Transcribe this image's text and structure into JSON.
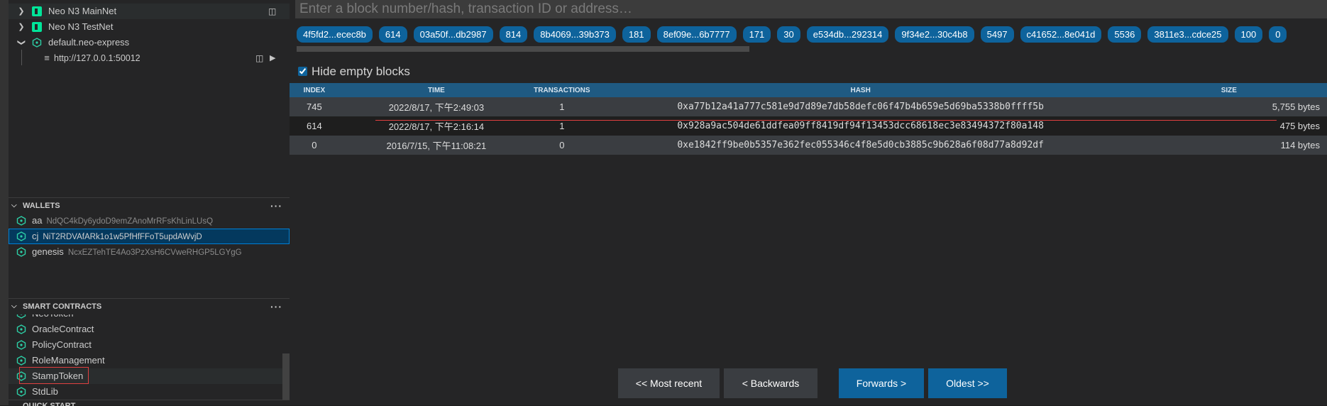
{
  "sidebar": {
    "networks": [
      {
        "label": "Neo N3 MainNet"
      },
      {
        "label": "Neo N3 TestNet"
      },
      {
        "label": "default.neo-express"
      }
    ],
    "rpc_url": "http://127.0.0.1:50012",
    "wallets_header": "WALLETS",
    "wallets": [
      {
        "name": "aa",
        "address": "NdQC4kDy6ydoD9emZAnoMrRFsKhLinLUsQ"
      },
      {
        "name": "cj",
        "address": "NiT2RDVAfARk1o1w5PfHfFFoT5updAWvjD"
      },
      {
        "name": "genesis",
        "address": "NcxEZTehTE4Ao3PzXsH6CVweRHGP5LGYgG"
      }
    ],
    "contracts_header": "SMART CONTRACTS",
    "contracts": [
      {
        "name": "NeoToken"
      },
      {
        "name": "OracleContract"
      },
      {
        "name": "PolicyContract"
      },
      {
        "name": "RoleManagement"
      },
      {
        "name": "StampToken"
      },
      {
        "name": "StdLib"
      }
    ],
    "quickstart_header": "QUICK START"
  },
  "main": {
    "search_placeholder": "Enter a block number/hash, transaction ID or address…",
    "history": [
      "4f5fd2...ecec8b",
      "614",
      "03a50f...db2987",
      "814",
      "8b4069...39b373",
      "181",
      "8ef09e...6b7777",
      "171",
      "30",
      "e534db...292314",
      "9f34e2...30c4b8",
      "5497",
      "c41652...8e041d",
      "5536",
      "3811e3...cdce25",
      "100",
      "0"
    ],
    "hide_empty_label": "Hide empty blocks",
    "hide_empty_checked": true,
    "columns": {
      "index": "INDEX",
      "time": "TIME",
      "transactions": "TRANSACTIONS",
      "hash": "HASH",
      "size": "SIZE"
    },
    "blocks": [
      {
        "index": "745",
        "time": "2022/8/17, 下午2:49:03",
        "transactions": "1",
        "hash": "0xa77b12a41a777c581e9d7d89e7db58defc06f47b4b659e5d69ba5338b0ffff5b",
        "size": "5,755 bytes"
      },
      {
        "index": "614",
        "time": "2022/8/17, 下午2:16:14",
        "transactions": "1",
        "hash": "0x928a9ac504de61ddfea09ff8419df94f13453dcc68618ec3e83494372f80a148",
        "size": "475 bytes"
      },
      {
        "index": "0",
        "time": "2016/7/15, 下午11:08:21",
        "transactions": "0",
        "hash": "0xe1842ff9be0b5357e362fec055346c4f8e5d0cb3885c9b628a6f08d77a8d92df",
        "size": "114 bytes"
      }
    ],
    "nav": {
      "most_recent": "<< Most recent",
      "backwards": "< Backwards",
      "forwards": "Forwards >",
      "oldest": "Oldest >>"
    }
  },
  "colors": {
    "accent": "#0e639c",
    "neo_green": "#00e599",
    "annotation_red": "#e04040",
    "contract_teal": "#2dcfa6"
  }
}
